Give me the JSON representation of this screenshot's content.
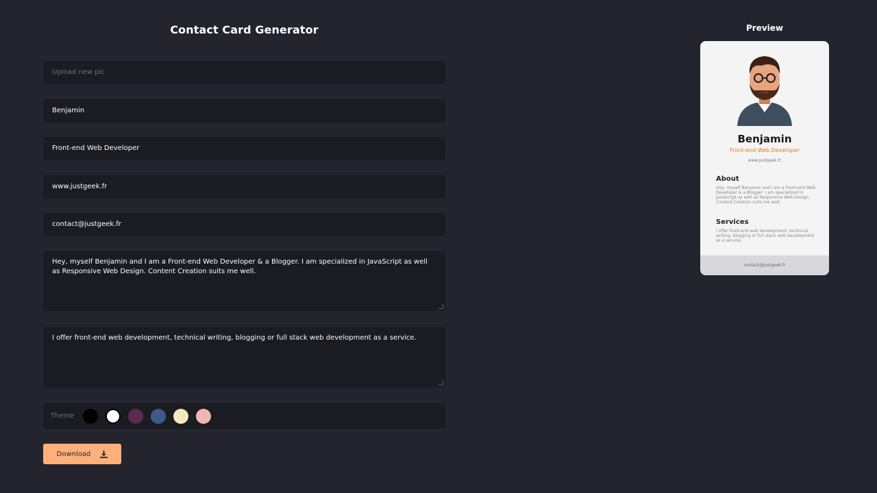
{
  "form": {
    "title": "Contact Card Generator",
    "upload_placeholder": "Upload new pic",
    "name_value": "Benjamin",
    "job_value": "Front-end Web Developer",
    "website_value": "www.justgeek.fr",
    "email_value": "contact@justgeek.fr",
    "about_value": "Hey, myself Benjamin and I am a Front-end Web Developer & a Blogger. I am specialized in JavaScript as well as Responsive Web Design. Content Creation suits me well.",
    "services_value": "I offer front-end web development, technical writing, blogging or full stack web development as a service.",
    "theme_label": "Theme",
    "theme_colors": [
      "#000000",
      "#ffffff",
      "#5b2a4e",
      "#3f5a86",
      "#f3e8c0",
      "#f0b5b5"
    ],
    "download_label": "Download",
    "download_icon": "download-icon"
  },
  "preview": {
    "title": "Preview",
    "name": "Benjamin",
    "job": "Front-end Web Developer",
    "website": "www.justgeek.fr",
    "about_heading": "About",
    "about_text": "Hey, myself Benjamin and I am a Front-end Web Developer & a Blogger. I am specialized in JavaScript as well as Responsive Web Design. Content Creation suits me well.",
    "services_heading": "Services",
    "services_text": "I offer front-end web development, technical writing, blogging or full stack web development as a service.",
    "footer_email": "contact@justgeek.fr",
    "accent_color": "#e07b2e"
  }
}
